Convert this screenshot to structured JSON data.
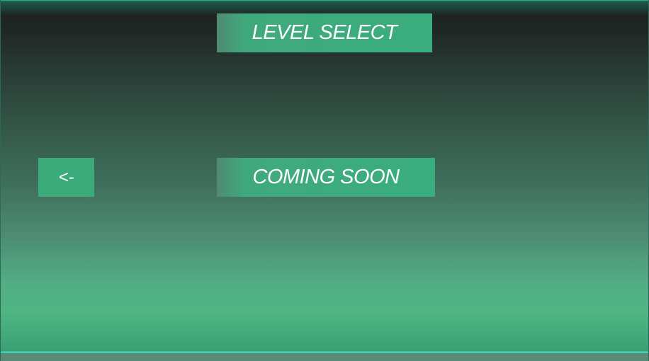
{
  "screen": {
    "title": "LEVEL SELECT",
    "back_label": "<-",
    "levels_message": "COMING SOON"
  },
  "colors": {
    "panel": "#3aad7e",
    "accent_line": "#3ee2c6",
    "background_top": "#1f2625",
    "background_bottom": "#4fb583",
    "text": "#ffffff"
  }
}
